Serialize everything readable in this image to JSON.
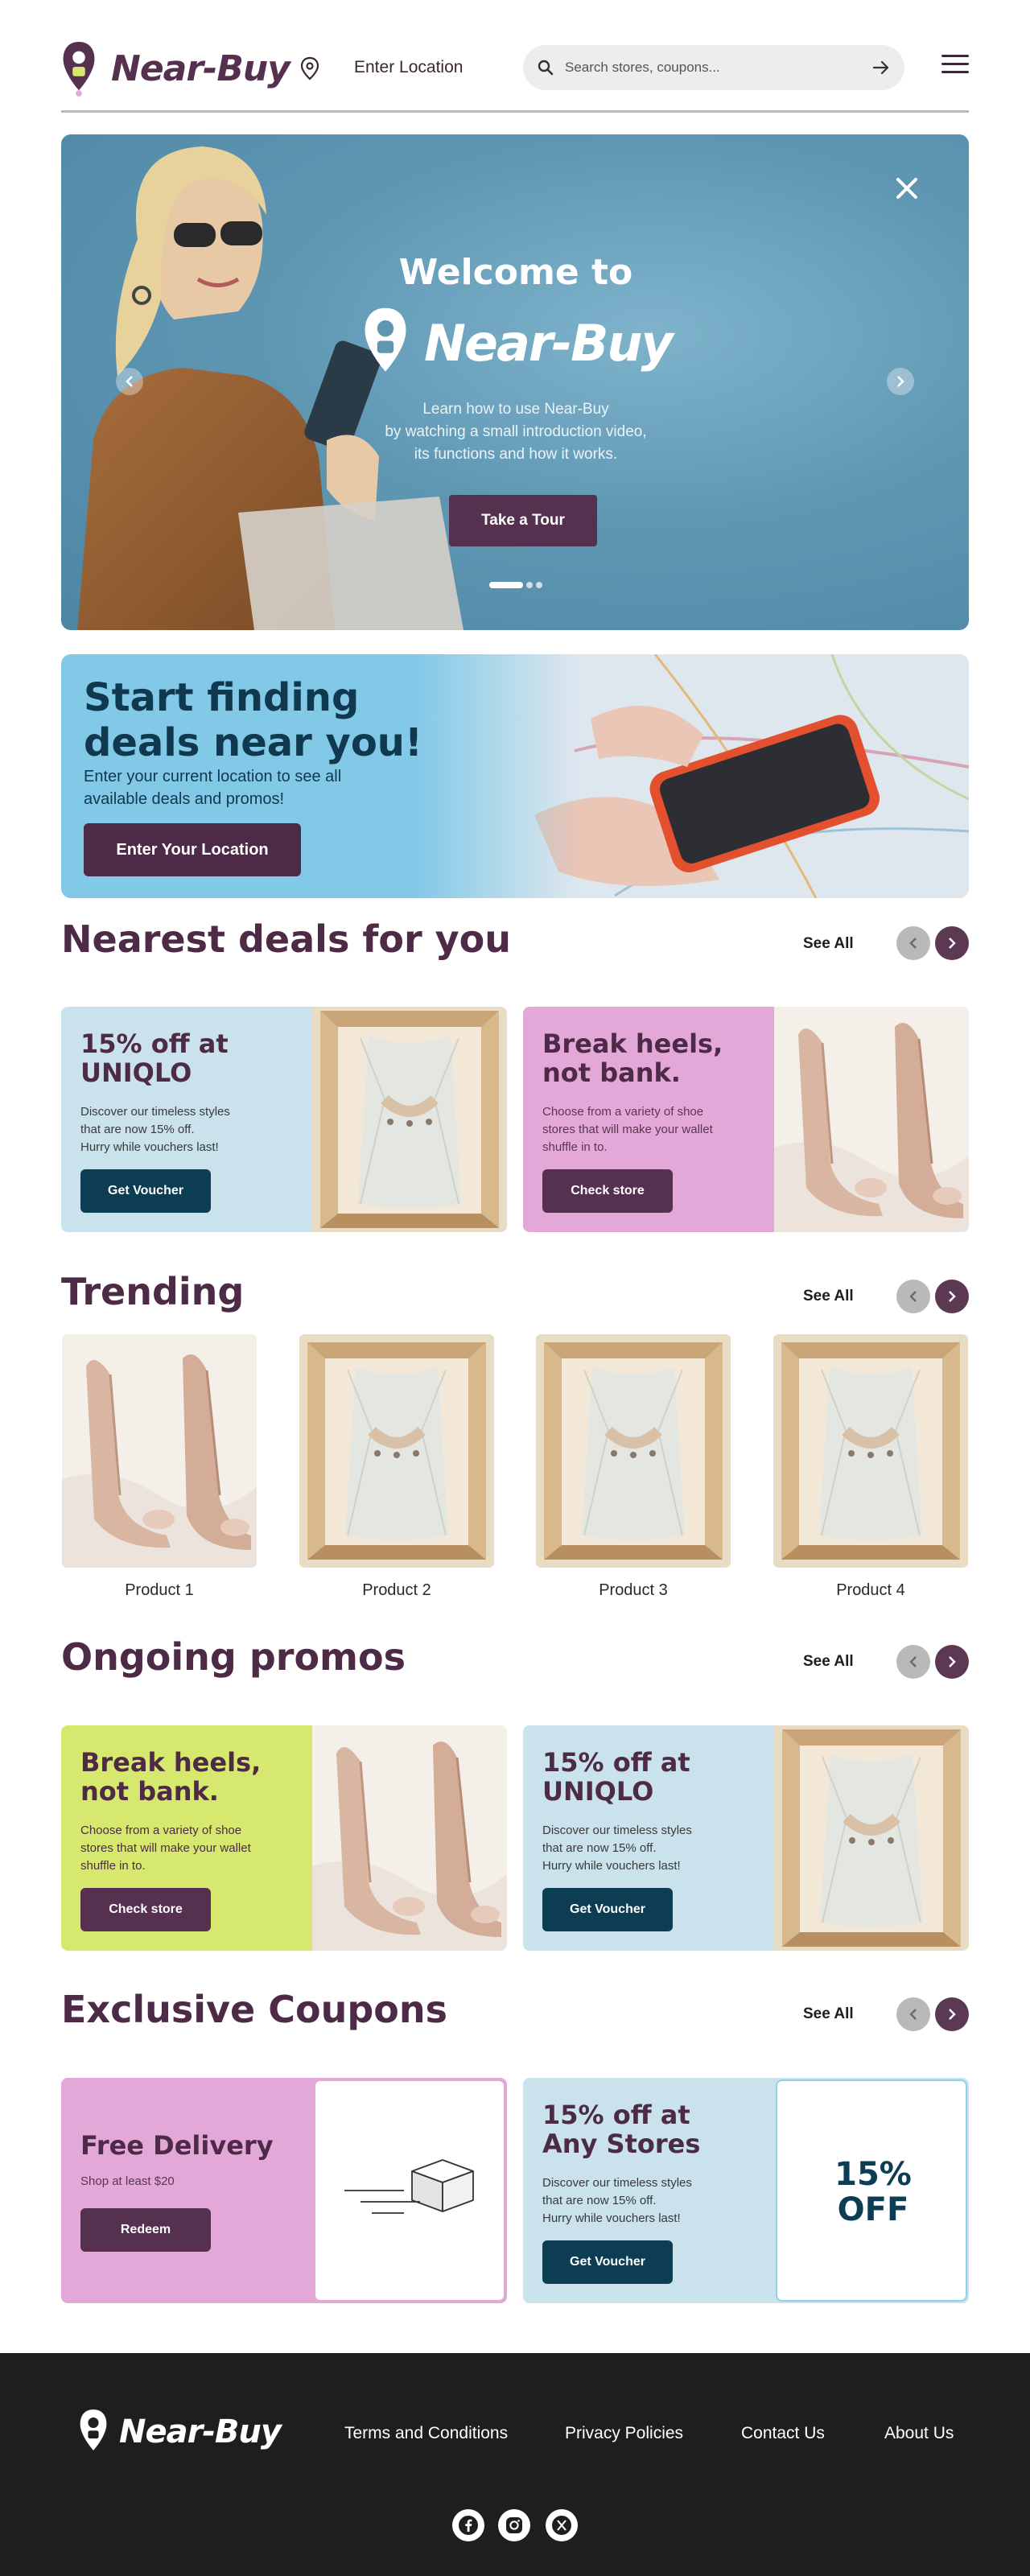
{
  "brand": {
    "name": "Near-Buy",
    "primary": "#55304f",
    "accent": "#0d3d53"
  },
  "header": {
    "location_label": "Enter Location",
    "search_placeholder": "Search stores, coupons..."
  },
  "hero": {
    "welcome": "Welcome to",
    "brand": "Near-Buy",
    "description": "Learn how to use Near-Buy by watching a small introduction video, its functions and how it works.",
    "desc_lines": [
      "Learn how to use Near-Buy",
      "by watching a small introduction video,",
      "its functions and how it works."
    ],
    "button": "Take a Tour",
    "slides": 3,
    "active_slide": 1
  },
  "location_banner": {
    "title_lines": [
      "Start finding",
      "deals near you!"
    ],
    "desc_lines": [
      "Enter your current location to see all",
      "available deals and promos!"
    ],
    "button": "Enter Your Location"
  },
  "sections": {
    "nearest": {
      "title": "Nearest deals for you",
      "see_all": "See All"
    },
    "trending": {
      "title": "Trending",
      "see_all": "See All"
    },
    "promos": {
      "title": "Ongoing promos",
      "see_all": "See All"
    },
    "coupons": {
      "title": "Exclusive Coupons",
      "see_all": "See All"
    }
  },
  "nearest_deals": [
    {
      "title_lines": [
        "15% off at",
        "UNIQLO"
      ],
      "desc_lines": [
        "Discover our timeless styles",
        "that are now 15% off.",
        "Hurry while vouchers last!"
      ],
      "button": "Get Voucher",
      "image": "shirt-box"
    },
    {
      "title_lines": [
        "Break heels,",
        "not bank."
      ],
      "desc_lines": [
        "Choose from a variety of shoe",
        "stores that will make your wallet",
        "shuffle in to."
      ],
      "button": "Check store",
      "image": "heels"
    }
  ],
  "trending": [
    {
      "name": "Product 1",
      "image": "heels"
    },
    {
      "name": "Product 2",
      "image": "shirt-box"
    },
    {
      "name": "Product 3",
      "image": "shirt-box"
    },
    {
      "name": "Product 4",
      "image": "shirt-box"
    }
  ],
  "promos": [
    {
      "title_lines": [
        "Break heels,",
        "not bank."
      ],
      "desc_lines": [
        "Choose from a variety of shoe",
        "stores that will make your wallet",
        "shuffle in to."
      ],
      "button": "Check store",
      "image": "heels"
    },
    {
      "title_lines": [
        "15% off at",
        "UNIQLO"
      ],
      "desc_lines": [
        "Discover our timeless styles",
        "that are now 15% off.",
        "Hurry while vouchers last!"
      ],
      "button": "Get Voucher",
      "image": "shirt-box"
    }
  ],
  "coupons": [
    {
      "title_lines": [
        "Free Delivery"
      ],
      "desc_lines": [
        "Shop at least $20"
      ],
      "button": "Redeem",
      "image": "box-icon"
    },
    {
      "title_lines": [
        "15% off at",
        "Any Stores"
      ],
      "desc_lines": [
        "Discover our timeless styles",
        "that are now 15% off.",
        "Hurry while vouchers last!"
      ],
      "button": "Get Voucher",
      "pct_lines": [
        "15%",
        "OFF"
      ]
    }
  ],
  "footer": {
    "brand": "Near-Buy",
    "links": [
      "Terms and Conditions",
      "Privacy Policies",
      "Contact Us",
      "About Us"
    ],
    "social": [
      "facebook-icon",
      "instagram-icon",
      "x-icon"
    ]
  }
}
